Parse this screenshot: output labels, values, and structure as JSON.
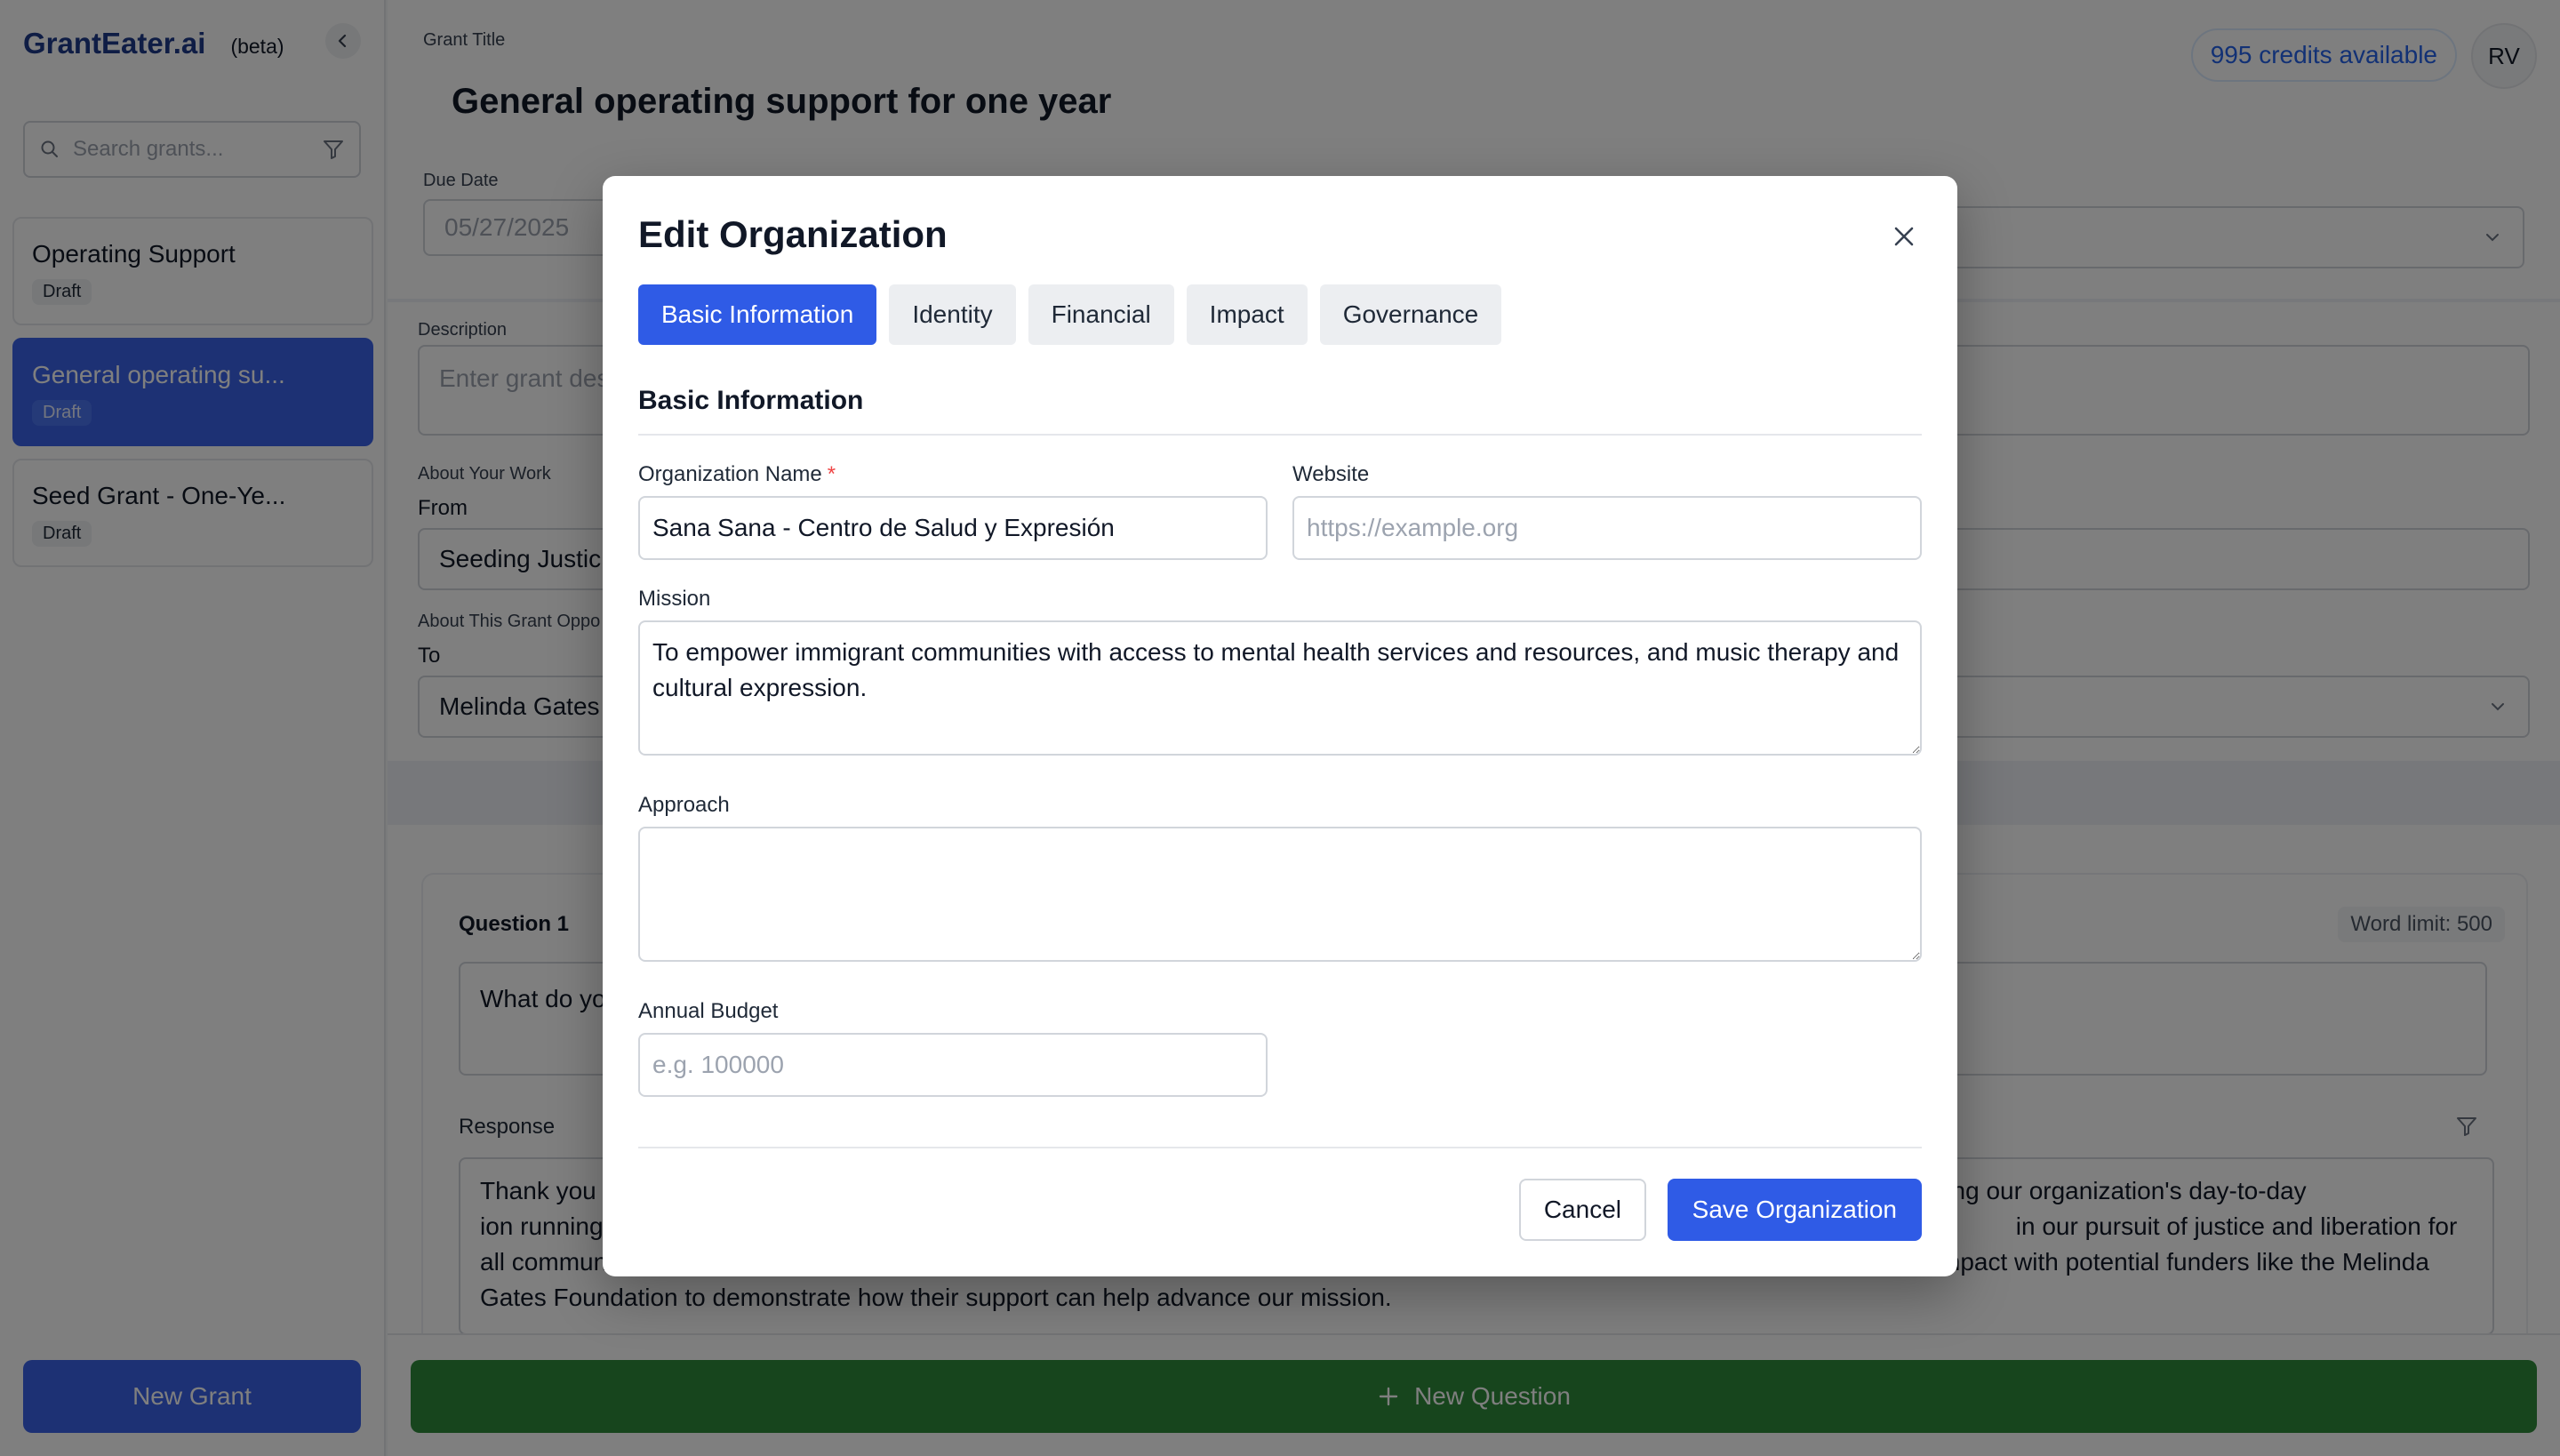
{
  "sidebar": {
    "brand": "GrantEater.ai",
    "beta": "(beta)",
    "search_placeholder": "Search grants...",
    "grants": [
      {
        "title": "Operating Support",
        "status": "Draft"
      },
      {
        "title": "General operating su...",
        "status": "Draft",
        "active": true
      },
      {
        "title": "Seed Grant - One-Ye...",
        "status": "Draft"
      }
    ],
    "new_grant_label": "New Grant"
  },
  "header": {
    "grant_title_label": "Grant Title",
    "grant_title": "General operating support for one year",
    "credits": "995 credits available",
    "avatar_initials": "RV"
  },
  "form": {
    "due_date_label": "Due Date",
    "due_date_value": "05/27/2025",
    "description_label": "Description",
    "description_placeholder": "Enter grant desc",
    "about_work_label": "About Your Work",
    "from_label": "From",
    "from_value": "Seeding Justic",
    "about_opportunity_label": "About This Grant Oppo",
    "to_label": "To",
    "to_value": "Melinda Gates"
  },
  "question": {
    "label": "Question 1",
    "word_limit": "Word limit: 500",
    "question_text": "What do yo",
    "response_label": "Response",
    "response_text": "Thank you                                                                                                                                                                 are crucial for sustaining our organization's day-to-day                                                                                                                                         ion running smoothly. These funds are flexible and                                                                                                                                              in our pursuit of justice and liberation for all communities. While specific details about the grant opportunity are not provided, we are eager to share more about our work and impact with potential funders like the Melinda Gates Foundation to demonstrate how their support can help advance our mission."
  },
  "new_question_label": "New Question",
  "modal": {
    "title": "Edit Organization",
    "tabs": [
      "Basic Information",
      "Identity",
      "Financial",
      "Impact",
      "Governance"
    ],
    "active_tab": "Basic Information",
    "section_heading": "Basic Information",
    "org_name_label": "Organization Name",
    "org_name_required": "*",
    "org_name_value": "Sana Sana - Centro de Salud y Expresión",
    "website_label": "Website",
    "website_placeholder": "https://example.org",
    "mission_label": "Mission",
    "mission_value": "To empower immigrant communities with access to mental health services and resources, and music therapy and cultural expression.",
    "approach_label": "Approach",
    "approach_value": "",
    "budget_label": "Annual Budget",
    "budget_placeholder": "e.g. 100000",
    "cancel_label": "Cancel",
    "save_label": "Save Organization"
  },
  "colors": {
    "primary": "#2f5be6",
    "brand": "#1e3a8a",
    "success": "#2f8a3a",
    "required": "#ef4444"
  },
  "icons": [
    "chevron-left-icon",
    "search-icon",
    "filter-icon",
    "chevron-down-icon",
    "plus-icon",
    "close-icon"
  ]
}
